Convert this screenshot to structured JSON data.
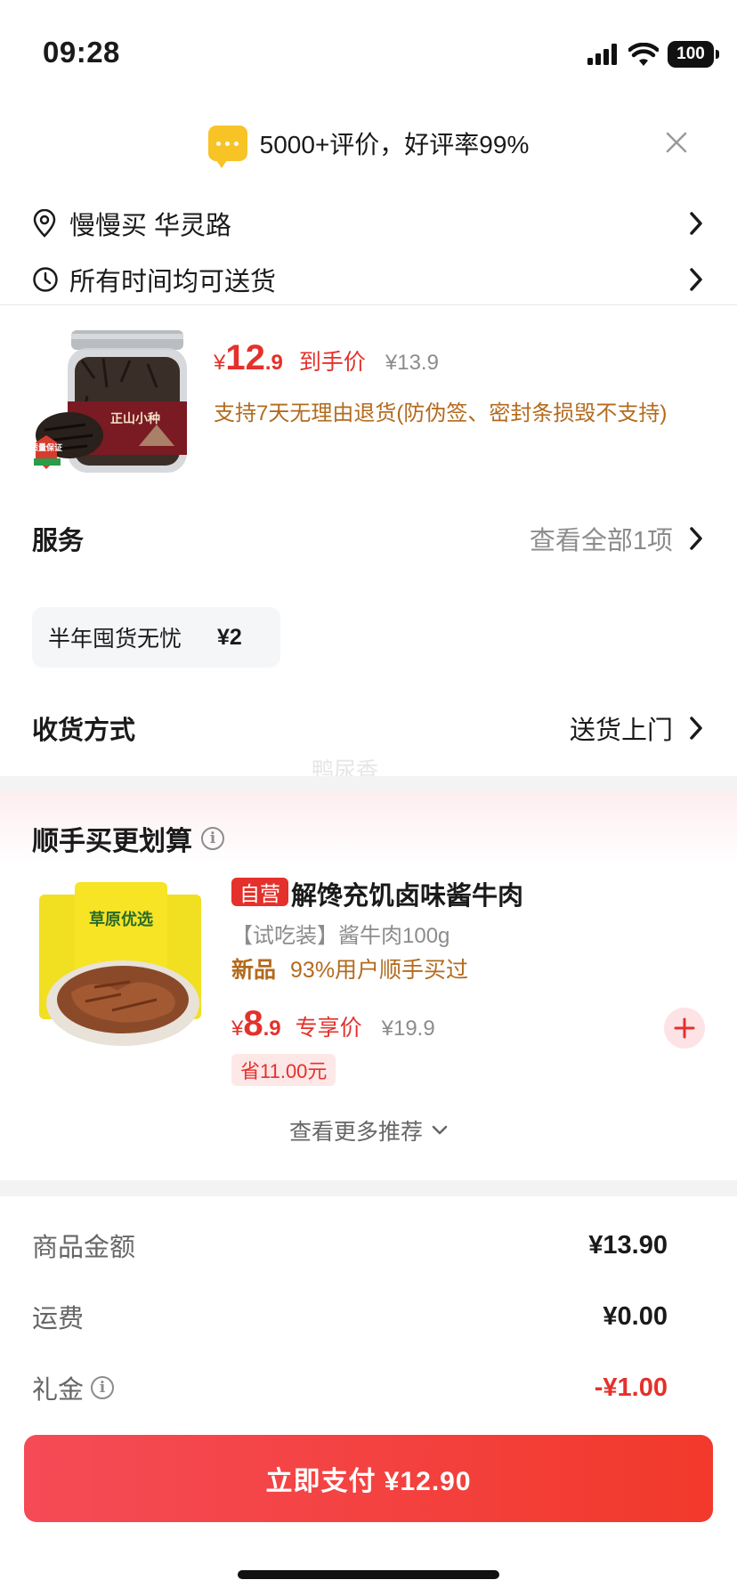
{
  "status_bar": {
    "time": "09:28",
    "battery": "100"
  },
  "review_banner": {
    "text": "5000+评价，好评率99%"
  },
  "address": {
    "text": "慢慢买 华灵路"
  },
  "delivery_time": {
    "text": "所有时间均可送货"
  },
  "product": {
    "image_label": "正山小种",
    "quality_badge": "质量保证",
    "price_yen": "¥",
    "price_int": "12",
    "price_dec": ".9",
    "price_label": "到手价",
    "original_price": "¥13.9",
    "return_note": "支持7天无理由退货(防伪签、密封条损毁不支持)"
  },
  "service": {
    "title": "服务",
    "view_all": "查看全部1项",
    "chip_label": "半年囤货无忧",
    "chip_price": "¥2"
  },
  "receive_method": {
    "title": "收货方式",
    "value": "送货上门"
  },
  "watermark": "鸭尿香",
  "promo": {
    "title": "顺手买更划算",
    "self_badge": "自营",
    "name": "解馋充饥卤味酱牛肉",
    "spec": "【试吃装】酱牛肉100g",
    "tag_new": "新品",
    "tag_text": "93%用户顺手买过",
    "price_yen": "¥",
    "price_int": "8",
    "price_dec": ".9",
    "price_label": "专享价",
    "original_price": "¥19.9",
    "save_text": "省11.00元",
    "image_label": "草原优选",
    "more": "查看更多推荐"
  },
  "summary": {
    "goods_label": "商品金额",
    "goods_value": "¥13.90",
    "shipping_label": "运费",
    "shipping_value": "¥0.00",
    "gift_label": "礼金",
    "gift_value": "-¥1.00"
  },
  "pay_button": {
    "label": "立即支付 ¥12.90"
  },
  "colors": {
    "accent": "#e4312b",
    "warm_text": "#b26b1e",
    "muted": "#8c8c8c"
  }
}
